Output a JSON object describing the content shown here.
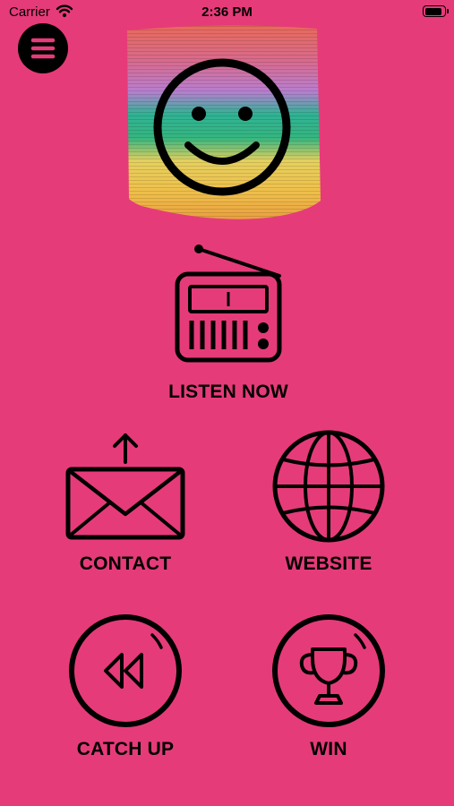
{
  "status_bar": {
    "carrier": "Carrier",
    "time": "2:36 PM",
    "wifi_icon": "wifi-icon",
    "battery_icon": "battery-icon"
  },
  "menu": {
    "icon": "hamburger-menu-icon"
  },
  "logo": {
    "icon": "rainbow-slinky-smiley-logo"
  },
  "tiles": {
    "listen_now": {
      "label": "LISTEN NOW",
      "icon": "radio-icon"
    },
    "contact": {
      "label": "CONTACT",
      "icon": "envelope-upload-icon"
    },
    "website": {
      "label": "WEBSITE",
      "icon": "globe-icon"
    },
    "catch_up": {
      "label": "CATCH UP",
      "icon": "rewind-icon"
    },
    "win": {
      "label": "WIN",
      "icon": "trophy-icon"
    }
  },
  "colors": {
    "background": "#E63B79",
    "foreground": "#000000"
  }
}
